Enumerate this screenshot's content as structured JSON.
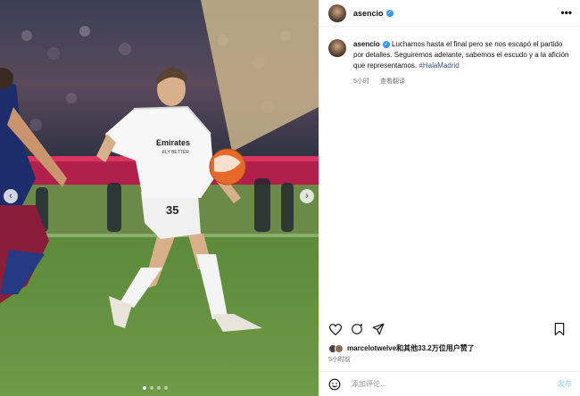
{
  "post": {
    "username": "asencio",
    "more_label": "•••",
    "caption": {
      "username": "asencio",
      "text": "Luchamos hasta el final pero se nos escapó el partido por detalles. Seguiremos adelante, sabemos el escudo y a la afición que representamos.",
      "hashtag": "#HalaMadrid",
      "time": "5小时",
      "translate": "查看翻译"
    },
    "likes_text": "marcelotwelve和其他33.2万位用户赞了",
    "time": "5小时前",
    "comment_placeholder": "添加评论...",
    "post_label": "发布",
    "photo": {
      "shirt_sponsor": "Emirates\nFLY BETTER",
      "shirt_number": "35"
    }
  },
  "icons": [
    "heart-icon",
    "comment-icon",
    "share-icon",
    "bookmark-icon",
    "emoji-icon",
    "verified-icon",
    "chevron-left-icon",
    "chevron-right-icon"
  ],
  "carousel": {
    "total": 4,
    "active": 1
  },
  "colors": {
    "verified": "#3897f0",
    "hashtag": "#385185",
    "post_btn": "#b3dbff"
  }
}
